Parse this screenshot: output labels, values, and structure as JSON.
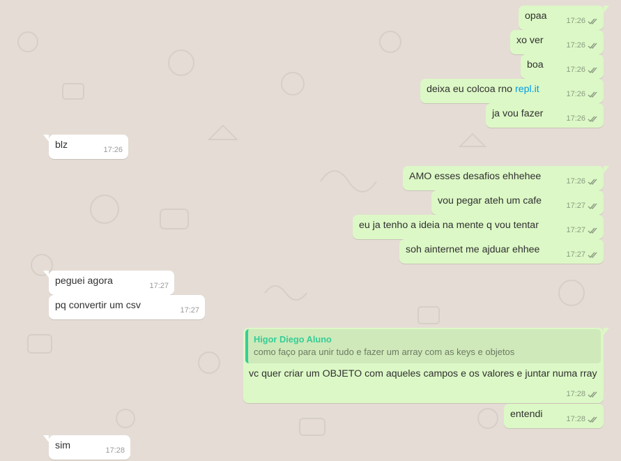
{
  "colors": {
    "wallpaper": "#e5ddd5",
    "outgoing": "#dcf8c6",
    "incoming": "#ffffff",
    "link": "#039be5",
    "reply_accent": "#35cd96",
    "ticks": "#8b9a82"
  },
  "messages": [
    {
      "dir": "out",
      "text": "opaa",
      "time": "17:26",
      "ticks": "double-check-icon"
    },
    {
      "dir": "out",
      "text": "xo ver",
      "time": "17:26",
      "ticks": "double-check-icon"
    },
    {
      "dir": "out",
      "text": "boa",
      "time": "17:26",
      "ticks": "double-check-icon"
    },
    {
      "dir": "out",
      "text_before": "deixa eu colcoa rno ",
      "link": "repl.it",
      "time": "17:26",
      "ticks": "double-check-icon"
    },
    {
      "dir": "out",
      "text": "ja vou fazer",
      "time": "17:26",
      "ticks": "double-check-icon"
    },
    {
      "dir": "in",
      "text": "blz",
      "time": "17:26"
    },
    {
      "dir": "out",
      "text": "AMO esses desafios ehhehee",
      "time": "17:26",
      "ticks": "double-check-icon"
    },
    {
      "dir": "out",
      "text": "vou pegar ateh um cafe",
      "time": "17:27",
      "ticks": "double-check-icon"
    },
    {
      "dir": "out",
      "text": "eu ja tenho a ideia na mente q vou tentar",
      "time": "17:27",
      "ticks": "double-check-icon"
    },
    {
      "dir": "out",
      "text": "soh ainternet me ajduar ehhee",
      "time": "17:27",
      "ticks": "double-check-icon"
    },
    {
      "dir": "in",
      "text": "peguei agora",
      "time": "17:27"
    },
    {
      "dir": "in",
      "text": "pq convertir um csv",
      "time": "17:27"
    },
    {
      "dir": "out",
      "quote_name": "Higor Diego Aluno",
      "quote_text": "como faço para unir tudo e fazer um array com as keys e objetos",
      "text": "vc quer criar um OBJETO com aqueles campos e os valores e juntar numa rray",
      "time": "17:28",
      "ticks": "double-check-icon"
    },
    {
      "dir": "out",
      "text": "entendi",
      "time": "17:28",
      "ticks": "double-check-icon"
    },
    {
      "dir": "in",
      "text": "sim",
      "time": "17:28"
    }
  ]
}
